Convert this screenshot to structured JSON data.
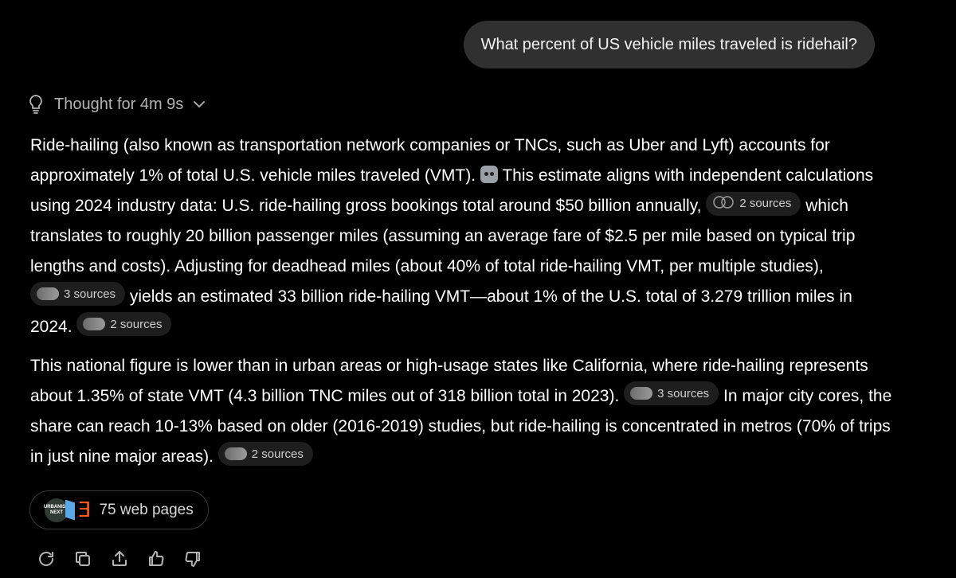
{
  "user_message": "What percent of US vehicle miles traveled is ridehail?",
  "thought_label": "Thought for 4m 9s",
  "answer": {
    "p1_s1": "Ride-hailing (also known as transportation network companies or TNCs, such as Uber and Lyft) accounts for approximately 1% of total U.S. vehicle miles traveled (VMT).",
    "p1_s2": "This estimate aligns with independent calculations using 2024 industry data: U.S. ride-hailing gross bookings total around $50 billion annually,",
    "p1_s3": "which translates to roughly 20 billion passenger miles (assuming an average fare of $2.5 per mile based on typical trip lengths and costs). Adjusting for deadhead miles (about 40% of total ride-hailing VMT, per multiple studies),",
    "p1_s4": "yields an estimated 33 billion ride-hailing VMT—about 1% of the U.S. total of 3.279 trillion miles in 2024.",
    "p2_s1": "This national figure is lower than in urban areas or high-usage states like California, where ride-hailing represents about 1.35% of state VMT (4.3 billion TNC miles out of 318 billion total in 2023).",
    "p2_s2": "In major city cores, the share can reach 10-13% based on older (2016-2019) studies, but ride-hailing is concentrated in metros (70% of trips in just nine major areas)."
  },
  "sources": {
    "chip1": "2 sources",
    "chip2": "3 sources",
    "chip3": "2 sources",
    "chip4": "3 sources",
    "chip5": "2 sources"
  },
  "web_pages": {
    "label": "75 web pages",
    "logo_text": "URBANISM NEXT",
    "logo_letter": "Ǝ"
  },
  "icons": {
    "thought": "lightbulb-icon",
    "expand": "chevron-down-icon",
    "actions": [
      "regenerate-icon",
      "copy-icon",
      "share-icon",
      "thumbs-up-icon",
      "thumbs-down-icon"
    ]
  },
  "colors": {
    "background": "#000000",
    "bubble": "#303030",
    "chip": "#1e1e1e",
    "muted_text": "#b4b4b4"
  }
}
